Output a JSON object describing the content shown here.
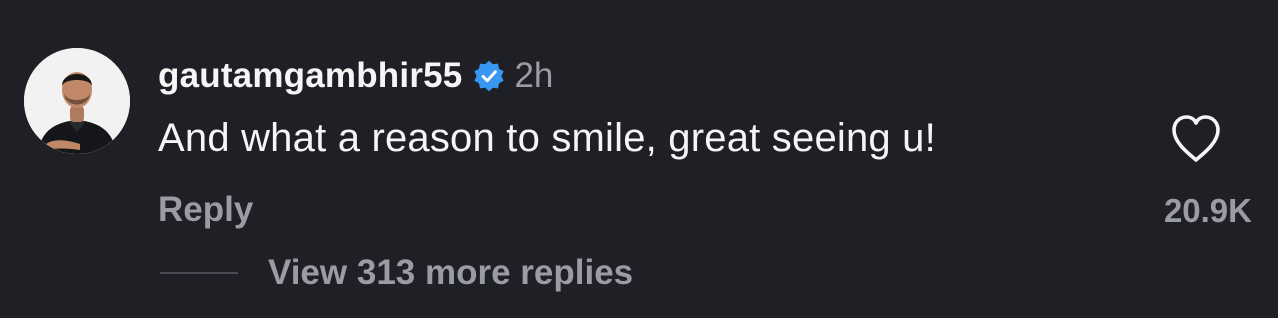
{
  "comment": {
    "username": "gautamgambhir55",
    "verified_icon": "verified-badge-icon",
    "time_ago": "2h",
    "text": "And what a reason to smile, great seeing u!",
    "reply_label": "Reply",
    "like_icon": "heart-outline-icon",
    "like_count": "20.9K",
    "view_replies_label": "View 313 more replies"
  },
  "colors": {
    "background": "#1f2026",
    "primary_text": "#f5f5f5",
    "secondary_text": "#9a9ba3",
    "verified_badge": "#3897f0"
  }
}
